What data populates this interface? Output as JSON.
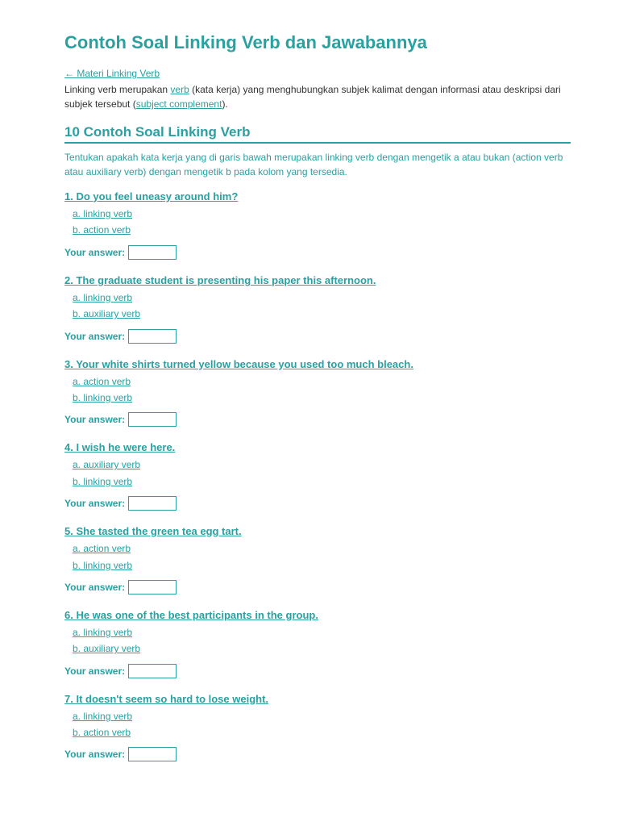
{
  "page": {
    "title": "Contoh Soal Linking Verb dan Jawabannya",
    "back_link": "← Materi Linking Verb",
    "intro": {
      "text_before": "Linking verb merupakan ",
      "link1": "verb",
      "text_middle1": " (kata kerja) yang menghubungkan subjek kalimat dengan informasi atau deskripsi dari subjek tersebut (",
      "link2": "subject complement",
      "text_after": ")."
    },
    "section_title": "10 Contoh Soal Linking Verb",
    "instruction": "Tentukan apakah kata kerja yang di garis bawah merupakan linking verb dengan mengetik a atau bukan (action verb atau auxiliary verb) dengan mengetik b pada kolom yang tersedia.",
    "answer_label": "Your answer:",
    "questions": [
      {
        "number": "1.",
        "text": "Do you feel uneasy around him?",
        "options": [
          "a.   linking verb",
          "b.   action verb"
        ]
      },
      {
        "number": "2.",
        "text": "The graduate student is presenting his paper this afternoon.",
        "options": [
          "a.   linking verb",
          "b.   auxiliary verb"
        ]
      },
      {
        "number": "3.",
        "text": "Your white shirts turned yellow because you used too much bleach.",
        "options": [
          "a.   action verb",
          "b.   linking verb"
        ]
      },
      {
        "number": "4.",
        "text": "I wish he were here.",
        "options": [
          "a.   auxiliary verb",
          "b.   linking verb"
        ]
      },
      {
        "number": "5.",
        "text": "She tasted the green tea egg tart.",
        "options": [
          "a.   action verb",
          "b.   linking verb"
        ]
      },
      {
        "number": "6.",
        "text": "He was one of the best participants in the group.",
        "options": [
          "a.   linking verb",
          "b.   auxiliary verb"
        ]
      },
      {
        "number": "7.",
        "text": "It doesn't seem so hard to lose weight.",
        "options": [
          "a.   linking verb",
          "b.   action verb"
        ]
      }
    ]
  }
}
